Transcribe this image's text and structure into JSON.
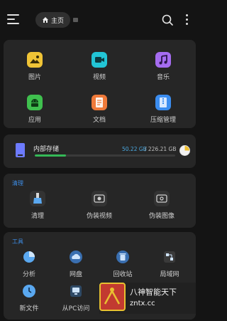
{
  "header": {
    "home_label": "主页"
  },
  "categories": [
    {
      "label": "图片",
      "color": "#f0c436",
      "icon": "image-icon"
    },
    {
      "label": "视频",
      "color": "#22c5d6",
      "icon": "video-icon"
    },
    {
      "label": "音乐",
      "color": "#a56cf0",
      "icon": "music-icon"
    },
    {
      "label": "应用",
      "color": "#3fc04e",
      "icon": "android-icon"
    },
    {
      "label": "文档",
      "color": "#f07a3a",
      "icon": "document-icon"
    },
    {
      "label": "压缩管理",
      "color": "#3b8df0",
      "icon": "archive-icon"
    }
  ],
  "storage": {
    "name": "内部存储",
    "used": "50.22 GB",
    "total": "/ 226.21 GB",
    "used_fraction": 0.222,
    "fill_color": "#35b857"
  },
  "clean": {
    "title": "清理",
    "items": [
      {
        "label": "清理",
        "icon": "broom-icon"
      },
      {
        "label": "伪装视频",
        "icon": "disguise-video-icon"
      },
      {
        "label": "伪装图像",
        "icon": "disguise-image-icon"
      }
    ]
  },
  "tools": {
    "title": "工具",
    "items": [
      {
        "label": "分析",
        "icon": "pie-chart-icon"
      },
      {
        "label": "网盘",
        "icon": "cloud-icon"
      },
      {
        "label": "回收站",
        "icon": "trash-icon"
      },
      {
        "label": "局域网",
        "icon": "lan-icon"
      },
      {
        "label": "新文件",
        "icon": "clock-icon"
      },
      {
        "label": "从PC访问",
        "icon": "pc-icon"
      }
    ]
  },
  "watermark": {
    "line1": "八神智能天下",
    "line2": "zntx.cc"
  },
  "accent": "#3d8de6"
}
